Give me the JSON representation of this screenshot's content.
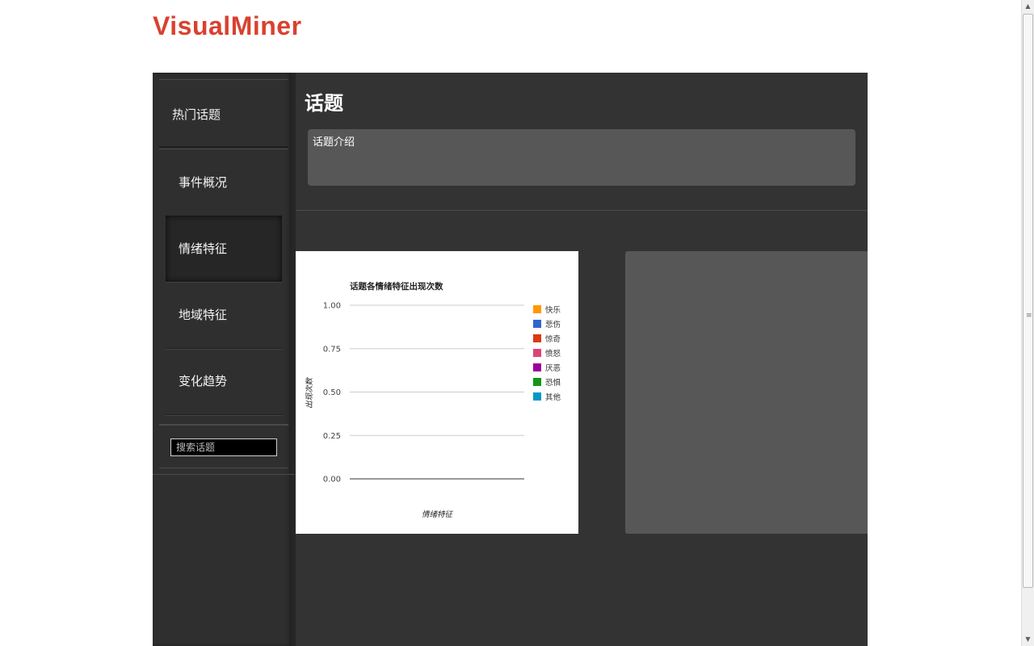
{
  "header": {
    "logo": "VisualMiner"
  },
  "sidebar": {
    "top_item": "热门话题",
    "items": [
      {
        "label": "事件概况"
      },
      {
        "label": "情绪特征"
      },
      {
        "label": "地域特征"
      },
      {
        "label": "变化趋势"
      }
    ],
    "active_index": 1,
    "search": {
      "placeholder": "搜索话题"
    }
  },
  "main": {
    "title": "话题",
    "intro": "话题介绍"
  },
  "chart_data": {
    "type": "bar",
    "title": "话题各情绪特征出现次数",
    "xlabel": "情绪特征",
    "ylabel": "出现次数",
    "ylim": [
      0,
      1
    ],
    "y_ticks": [
      "0.00",
      "0.25",
      "0.50",
      "0.75",
      "1.00"
    ],
    "categories": [],
    "series": [
      {
        "name": "快乐",
        "color": "#ff9900",
        "values": []
      },
      {
        "name": "悲伤",
        "color": "#3366cc",
        "values": []
      },
      {
        "name": "惊奇",
        "color": "#dc3912",
        "values": []
      },
      {
        "name": "愤怒",
        "color": "#dd4477",
        "values": []
      },
      {
        "name": "厌恶",
        "color": "#990099",
        "values": []
      },
      {
        "name": "恐惧",
        "color": "#109618",
        "values": []
      },
      {
        "name": "其他",
        "color": "#0099c6",
        "values": []
      }
    ],
    "grid": true,
    "legend": "right"
  },
  "scrollbar": {
    "up_icon": "arrow-up-icon",
    "down_icon": "arrow-down-icon"
  }
}
